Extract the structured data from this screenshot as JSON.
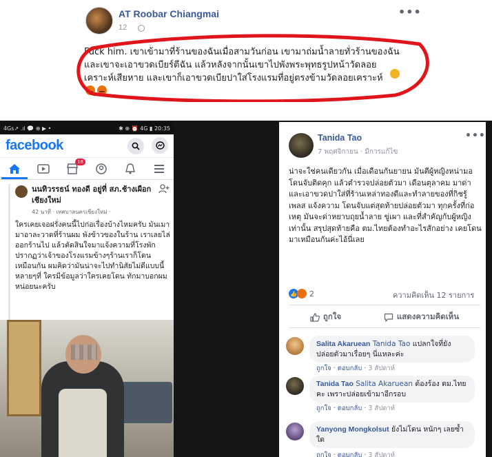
{
  "top_post": {
    "page_name": "AT Roobar Chiangmai",
    "time": "12",
    "text": "Fuck him. เขาเข้ามาที่ร้านของฉันเมื่อสามวันก่อน เขามาถ่มน้ำลายทั่วร้านของฉัน และเขาจะเอาขวดเบียร์ตีฉัน แล้วหลังจากนั้นเขาไปพังพระพุทธรูปหน้าวัดลอย เคราะห์เสียหาย และเขาก็เอาขวดเบียปาใส่โรงแรมที่อยู่ตรงข้ามวัดลอยเคราะห์",
    "more": "•••"
  },
  "phone": {
    "status_left": "4Gs↗ .ıl 💬 ⊕ ▶ •",
    "status_right": "✱ ⊕ ⏰ 4G ▮ 20:35",
    "app_logo": "facebook",
    "search_icon": "search-icon",
    "messenger_icon": "messenger-icon",
    "tabs": [
      "home-icon",
      "watch-icon",
      "marketplace-icon",
      "profile-icon",
      "notifications-icon",
      "menu-icon"
    ],
    "marketplace_badge": "18",
    "post": {
      "author": "นนทิวรรธน์ ทองดี อยู่ที่ สภ.ช้างเผือก เชียงใหม่",
      "time": "42 นาที · เทศบาลนครเชียงใหม่ · ",
      "text": "ใครเคยเจอฝรั่งคนนี้ไปก่อเรื่องบ้างไหมครับ มันเมามาอาละวาดที่ร้านผม พังข้าวของในร้าน เราเลยไล่ออกร้านไป แล้วตัดสินใจมาแจ้งความที่โรงพักปรากฏว่าเจ้าของโรงแรมข้างๆร้านเราก็โดนเหมือนกัน ผมคิดว่ามันน่าจะไปทำนิสัยไม่ดีแบบนี้หลายๆที่ ใครมีข้อมูลว่าใครเคยโดน ทักมาบอกผมหน่อยนะครับ"
    }
  },
  "panel": {
    "author": "Tanida Tao",
    "time": "7 พฤศจิกายน · มีการแก้ไข",
    "more": "•••",
    "text": "น่าจะใช่คนเดียวกัน เมื่อเดือนกันยายน มันตีผู้หญิงหน่ามอ โดนจับติดคุก แล้วตำรวจปล่อยตัวมา เดือนตุลาคม มาด่าและเอาขวดปาใส่ที่ร้านเหล่าทองดีและทำลายของที่กิชรู้เพลส แจ้งความ โดนจับแต่สุดท้ายปล่อยตัวมา ทุกครั้งที่ก่อเหตุ มันจะด่าหยาบถุยน้ำลาย ขู่เผา และที่สำคัญกับผู้หญิงเท่านั้น สรุปสุดท้ายคือ ตม.ไทยต้องทำอะไรสักอย่าง เคยโดนมาเหมือนกันค่ะไอ้นี่เลย",
    "reaction_count": "2",
    "comment_count": "ความคิดเห็น 12 รายการ",
    "like_label": "ถูกใจ",
    "comment_label": "แสดงความคิดเห็น",
    "comments": [
      {
        "name": "Salita Akaruean",
        "tag": "Tanida Tao",
        "text": "แปลกใจที่ยังปล่อยตัวมาเรื่อยๆ นี่แหละค่ะ",
        "like": "ถูกใจ",
        "reply": "ตอบกลับ",
        "time": "3 สัปดาห์"
      },
      {
        "name": "Tanida Tao",
        "tag": "Salita Akaruean",
        "text": "ต้องร้อง ตม.ไทย คะ เพราะปล่อยเข้ามาอีกรอบ",
        "like": "ถูกใจ",
        "reply": "ตอบกลับ",
        "time": "3 สัปดาห์"
      },
      {
        "name": "Yanyong Mongkolsut",
        "tag": "",
        "text": "ยังไม่โดน หนักๆ เลยซ้ำใด",
        "like": "ถูกใจ",
        "reply": "ตอบกลับ",
        "time": "3 สัปดาห์"
      }
    ]
  },
  "colors": {
    "fb_blue": "#1877f2",
    "link_blue": "#385898",
    "annotation_red": "#e0151b"
  }
}
